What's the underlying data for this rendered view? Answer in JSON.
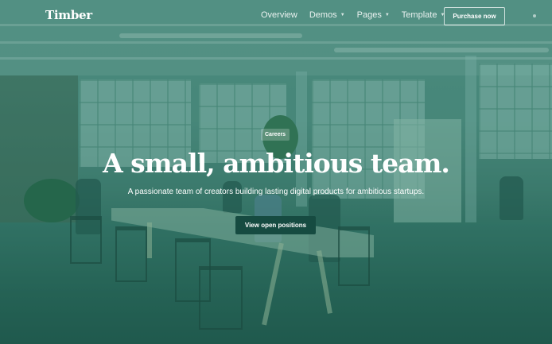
{
  "header": {
    "logo": "Timber",
    "nav": [
      {
        "label": "Overview",
        "has_dropdown": false
      },
      {
        "label": "Demos",
        "has_dropdown": true
      },
      {
        "label": "Pages",
        "has_dropdown": true
      },
      {
        "label": "Template",
        "has_dropdown": true
      }
    ],
    "purchase_label": "Purchase now"
  },
  "hero": {
    "badge": "Careers",
    "title": "A small, ambitious team.",
    "subtitle": "A passionate team of creators building lasting digital products for ambitious startups.",
    "cta_label": "View open positions"
  },
  "icons": {
    "dropdown": "caret-down-icon",
    "menu": "menu-dot-icon"
  },
  "colors": {
    "overlay": "#1f6b5d",
    "cta_background": "#164b41",
    "text": "#ffffff"
  }
}
